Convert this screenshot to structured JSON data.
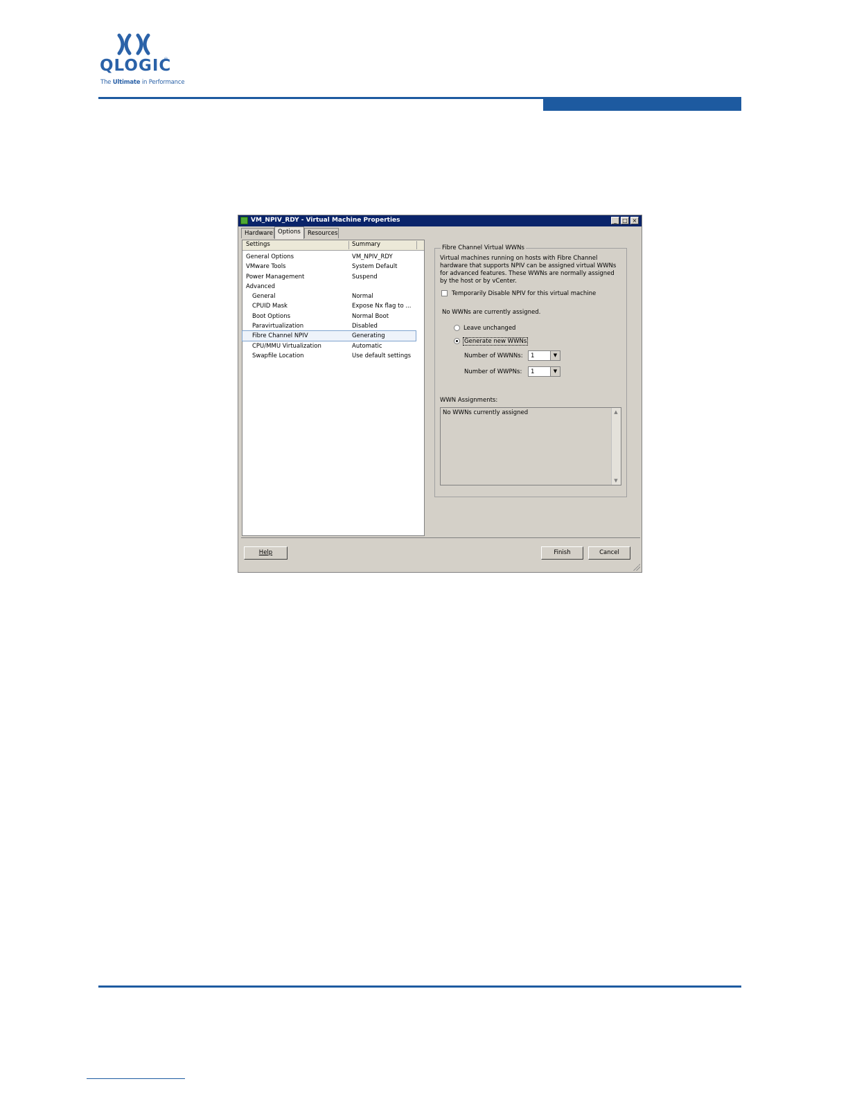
{
  "logo": {
    "name": "QLOGIC",
    "registered": "®",
    "tagline_prefix": "The ",
    "tagline_bold": "Ultimate",
    "tagline_suffix": " in Performance",
    "brand_color": "#2b62a8"
  },
  "accent_color": "#1d5aa0",
  "dialog": {
    "title": "VM_NPIV_RDY - Virtual Machine Properties",
    "titlebar_buttons": [
      "_",
      "□",
      "×"
    ],
    "tabs": [
      "Hardware",
      "Options",
      "Resources"
    ],
    "active_tab": "Options",
    "list": {
      "headers": [
        "Settings",
        "Summary"
      ],
      "rows": [
        {
          "setting": "General Options",
          "summary": "VM_NPIV_RDY"
        },
        {
          "setting": "VMware Tools",
          "summary": "System Default"
        },
        {
          "setting": "Power Management",
          "summary": "Suspend"
        },
        {
          "setting": "Advanced",
          "summary": ""
        },
        {
          "setting": "General",
          "summary": "Normal"
        },
        {
          "setting": "CPUID Mask",
          "summary": "Expose Nx flag to ..."
        },
        {
          "setting": "Boot Options",
          "summary": "Normal Boot"
        },
        {
          "setting": "Paravirtualization",
          "summary": "Disabled"
        },
        {
          "setting": "Fibre Channel NPIV",
          "summary": "Generating"
        },
        {
          "setting": "CPU/MMU Virtualization",
          "summary": "Automatic"
        },
        {
          "setting": "Swapfile Location",
          "summary": "Use default settings"
        }
      ],
      "selected_row": "Fibre Channel NPIV"
    },
    "npiv": {
      "group_title": "Fibre Channel Virtual WWNs",
      "description": "Virtual machines running on hosts with Fibre Channel hardware that supports NPIV can be assigned virtual WWNs for advanced features. These WWNs are normally assigned by the host or by vCenter.",
      "disable_checkbox_label": "Temporarily Disable NPIV for this virtual machine",
      "disable_checked": false,
      "status_text": "No WWNs are currently assigned.",
      "radio_leave": "Leave unchanged",
      "radio_generate": "Generate new WWNs",
      "selected_radio": "Generate new WWNs",
      "wwnn_label": "Number of WWNNs:",
      "wwnn_value": "1",
      "wwpn_label": "Number of WWPNs:",
      "wwpn_value": "1",
      "assignments_label": "WWN Assignments:",
      "assignments_text": "No WWNs currently assigned"
    },
    "buttons": {
      "help": "Help",
      "finish": "Finish",
      "cancel": "Cancel"
    }
  }
}
